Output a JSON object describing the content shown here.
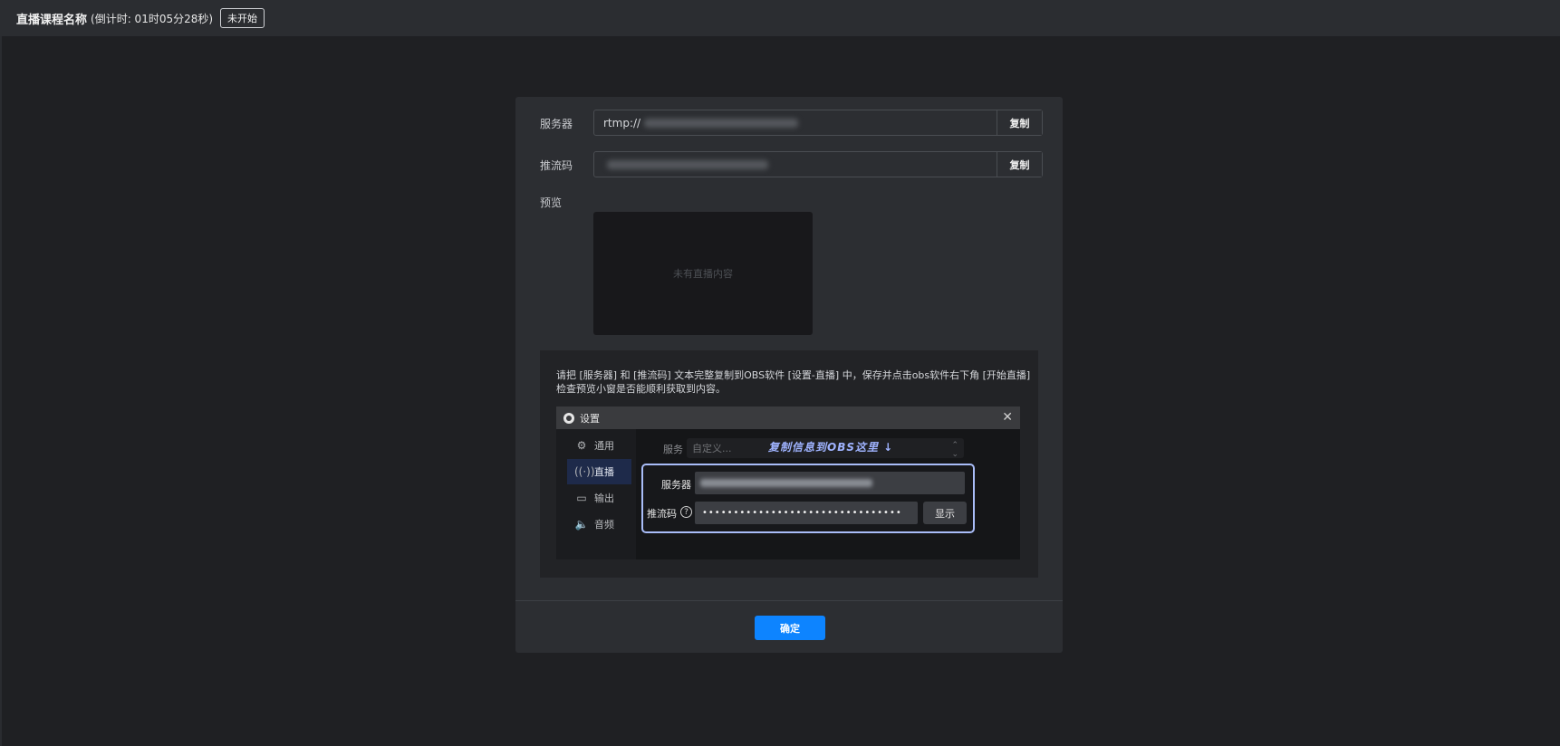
{
  "header": {
    "title": "直播课程名称",
    "countdown": "(倒计时: 01时05分28秒)",
    "status": "未开始"
  },
  "form": {
    "server_label": "服务器",
    "server_value": "rtmp://",
    "stream_key_label": "推流码",
    "copy_label": "复制",
    "preview_label": "预览",
    "preview_empty": "未有直播内容"
  },
  "guide": {
    "line1": "请把 [服务器] 和 [推流码] 文本完整复制到OBS软件 [设置-直播] 中，保存并点击obs软件右下角 [开始直播]",
    "line2": "检查预览小窗是否能顺利获取到内容。",
    "obs": {
      "window_title": "设置",
      "sidebar": [
        "通用",
        "直播",
        "输出",
        "音频"
      ],
      "active_item": "直播",
      "service_label": "服务",
      "service_value": "自定义...",
      "hint": "复制信息到OBS这里 ↓",
      "server_label": "服务器",
      "stream_key_label": "推流码",
      "stream_key_masked": "••••••••••••••••••••••••••••••••",
      "show_label": "显示"
    }
  },
  "footer": {
    "confirm_label": "确定"
  },
  "colors": {
    "accent": "#0d84ff",
    "highlight_border": "#a9bdf8",
    "background": "#1f2023"
  }
}
